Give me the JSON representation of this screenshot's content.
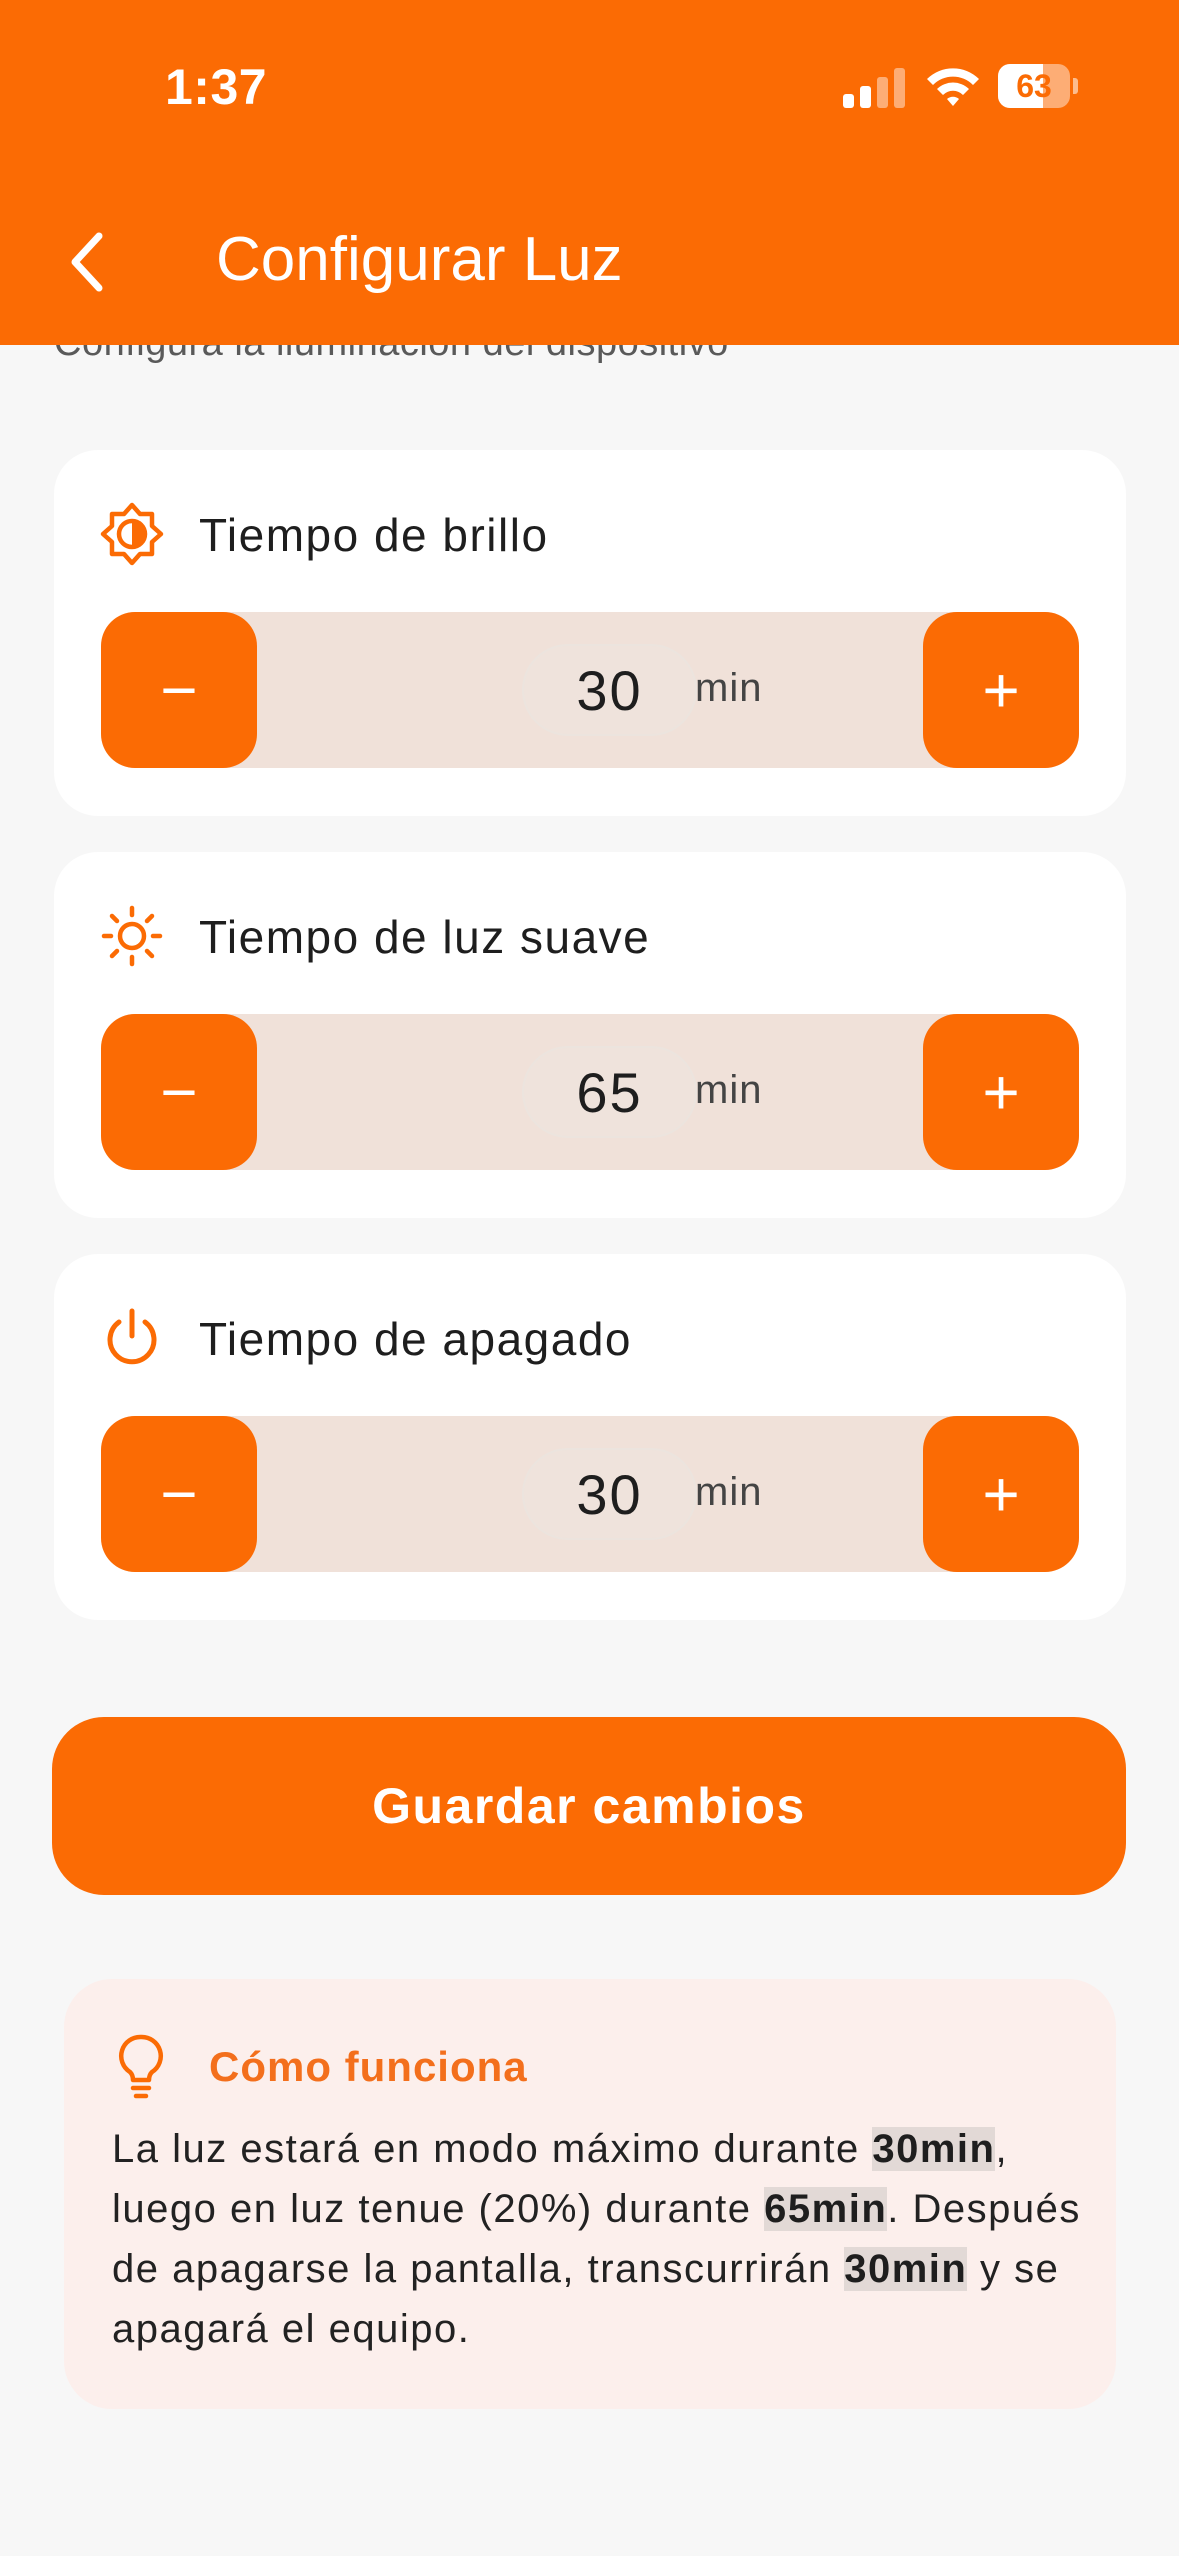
{
  "status_bar": {
    "time": "1:37",
    "battery": "63",
    "battery_level": 63
  },
  "header": {
    "title": "Configurar Luz",
    "back_icon": "chevron-left-icon"
  },
  "subtitle": "Configura la iluminación del dispositivo",
  "cards": [
    {
      "id": "brillo",
      "icon": "brightness-icon",
      "title": "Tiempo de brillo",
      "value": "30",
      "unit": "min",
      "minus": "−",
      "plus": "+"
    },
    {
      "id": "suave",
      "icon": "sun-icon",
      "title": "Tiempo de luz suave",
      "value": "65",
      "unit": "min",
      "minus": "−",
      "plus": "+"
    },
    {
      "id": "apagado",
      "icon": "power-icon",
      "title": "Tiempo de apagado",
      "value": "30",
      "unit": "min",
      "minus": "−",
      "plus": "+"
    }
  ],
  "save_button": {
    "label": "Guardar cambios"
  },
  "info": {
    "icon": "lightbulb-icon",
    "title": "Cómo funciona",
    "part1": "La luz estará en modo máximo durante ",
    "hl1": "30min",
    "part2": ", luego en luz tenue (20%) durante ",
    "hl2": "65min",
    "part3": ". Después de apagarse la pantalla, transcurrirán ",
    "hl3": "30min",
    "part4": " y se apagará el equipo."
  },
  "colors": {
    "accent": "#fb6b04",
    "background": "#f7f7f7",
    "stepper_track": "#f0e1d9",
    "info_bg": "#fcefec",
    "info_title": "#f36f1c"
  }
}
